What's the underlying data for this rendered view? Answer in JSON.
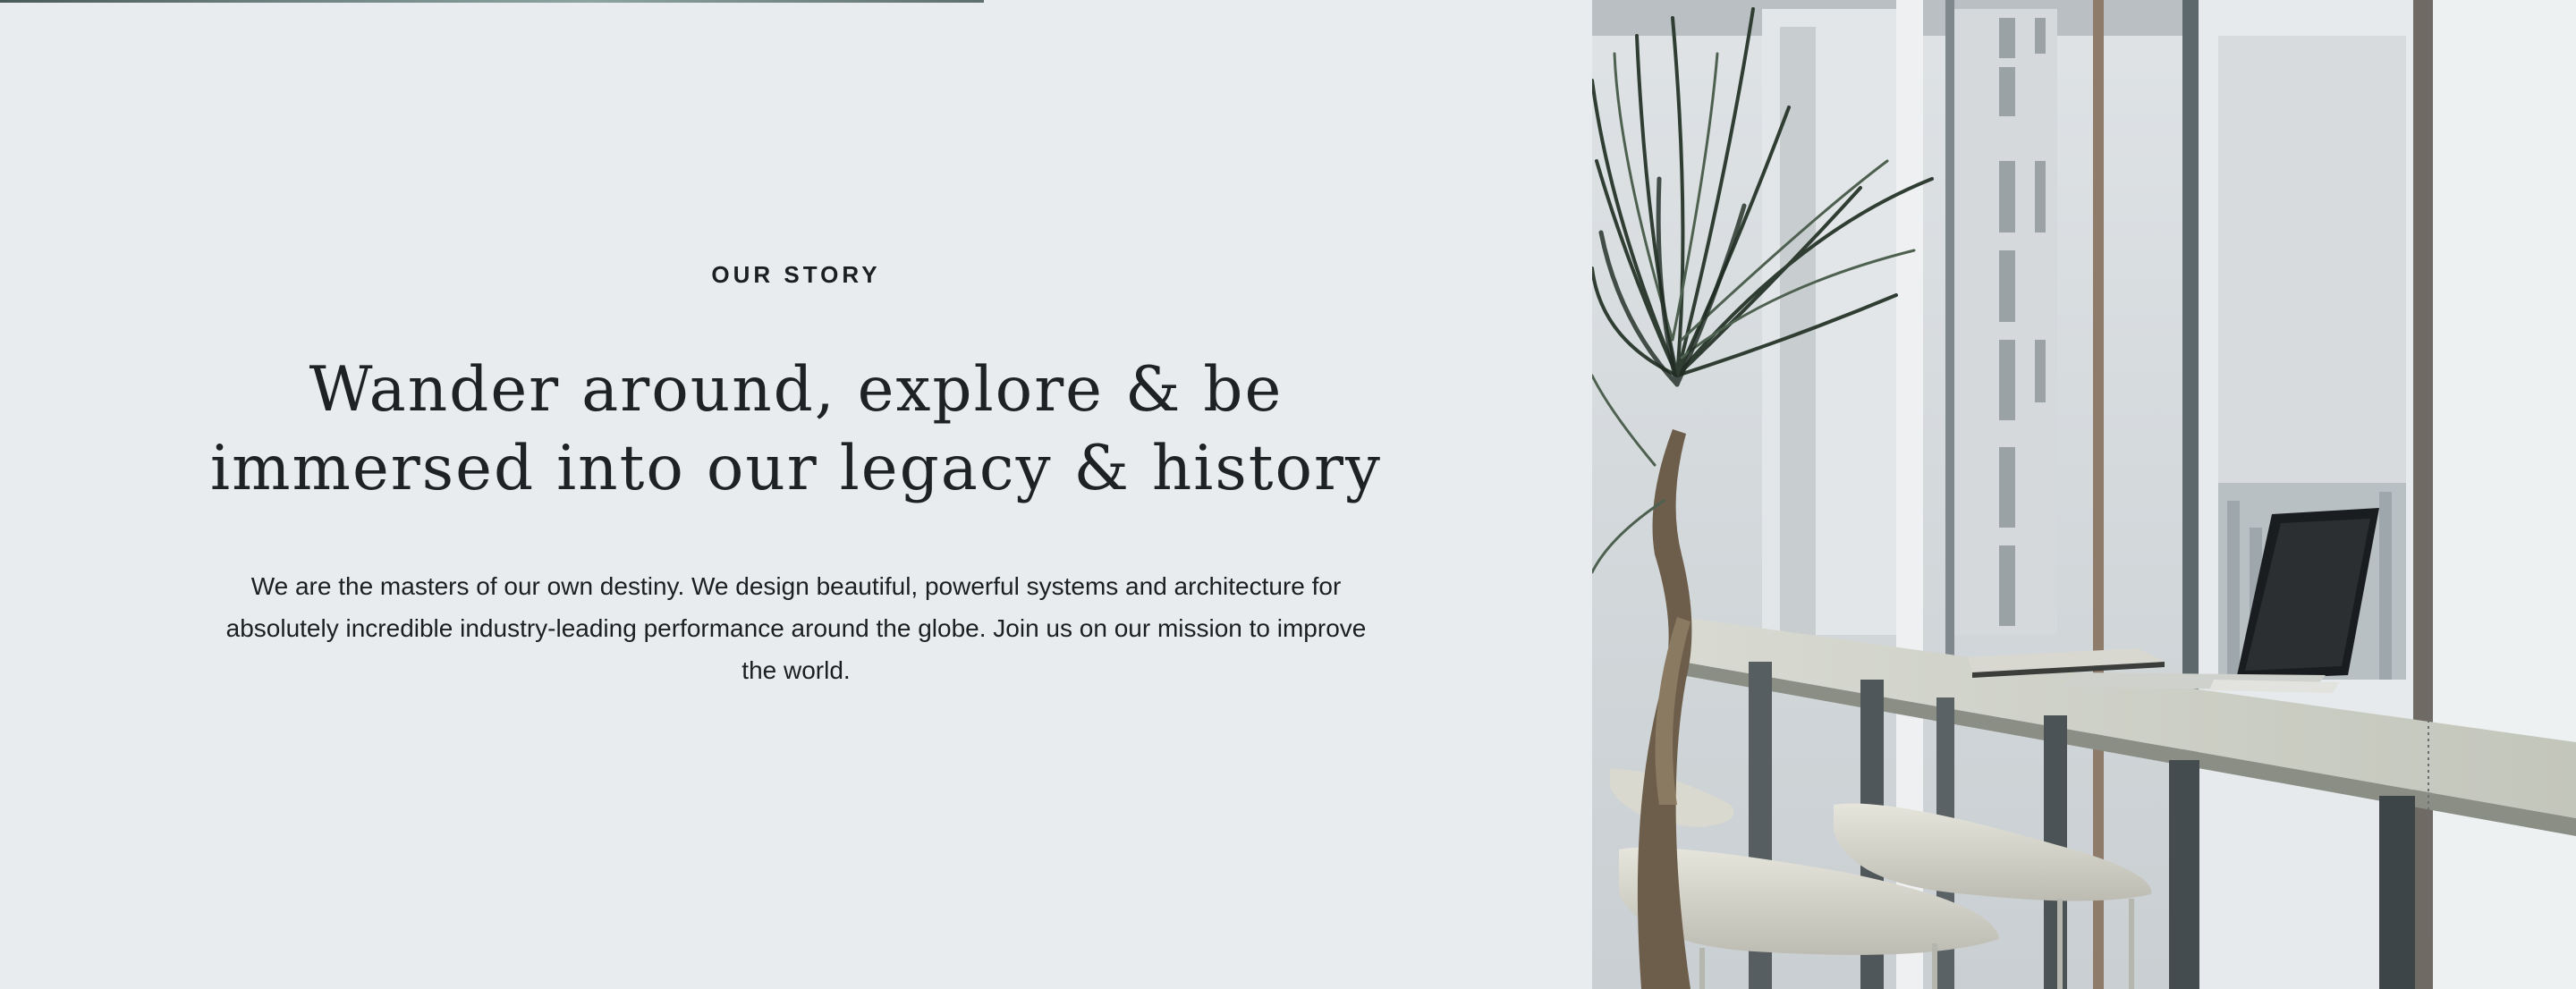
{
  "story": {
    "eyebrow": "OUR STORY",
    "headline_line1": "Wander around, explore & be",
    "headline_line2": "immersed into our legacy & history",
    "body": "We are the masters of our own destiny. We design beautiful, powerful systems and architecture for absolutely incredible industry-leading performance around the globe. Join us on our mission to improve the world."
  },
  "photo": {
    "icon": "office-photo-icon"
  },
  "colors": {
    "background": "#e9ecee",
    "text": "#1c1f22"
  }
}
